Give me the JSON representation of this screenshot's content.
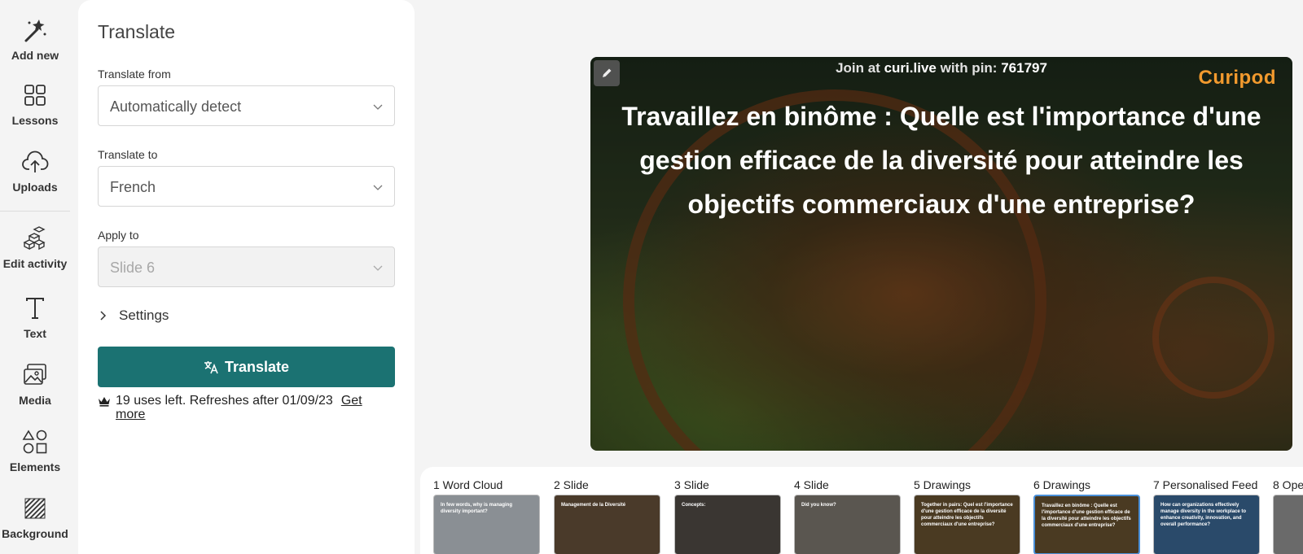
{
  "rail": {
    "items": [
      {
        "label": "Add new",
        "icon": "magic-wand-icon"
      },
      {
        "label": "Lessons",
        "icon": "grid-icon"
      },
      {
        "label": "Uploads",
        "icon": "cloud-upload-icon"
      },
      {
        "label": "Edit activity",
        "icon": "blocks-icon"
      },
      {
        "label": "Text",
        "icon": "text-icon"
      },
      {
        "label": "Media",
        "icon": "image-icon"
      },
      {
        "label": "Elements",
        "icon": "shapes-icon"
      },
      {
        "label": "Background",
        "icon": "hatch-icon"
      }
    ]
  },
  "panel": {
    "title": "Translate",
    "from": {
      "label": "Translate from",
      "value": "Automatically detect"
    },
    "to": {
      "label": "Translate to",
      "value": "French"
    },
    "apply": {
      "label": "Apply to",
      "value": "Slide 6",
      "disabled": true
    },
    "settings_label": "Settings",
    "translate_label": "Translate",
    "uses_text": "19 uses left. Refreshes after 01/09/23",
    "get_more": "Get more"
  },
  "slide": {
    "pin_prefix": "Join at",
    "pin_site": "curi.live",
    "pin_middle": "with pin:",
    "pin_code": "761797",
    "logo": "Curipod",
    "title": "Travaillez en binôme : Quelle est l'importance d'une gestion efficace de la diversité pour atteindre les objectifs commerciaux d'une entreprise?"
  },
  "thumbs": [
    {
      "label": "1 Word Cloud",
      "text": "In few words, why is managing diversity important?",
      "bg": "#8a8f94"
    },
    {
      "label": "2 Slide",
      "text": "Management de la Diversité",
      "bg": "#4a3a2a"
    },
    {
      "label": "3 Slide",
      "text": "Concepts:",
      "bg": "#3a3632"
    },
    {
      "label": "4 Slide",
      "text": "Did you know?",
      "bg": "#5a5650"
    },
    {
      "label": "5 Drawings",
      "text": "Together in pairs: Quel est l'importance d'une gestion efficace de la diversité pour atteindre les objectifs commerciaux d'une entreprise?",
      "bg": "#4a3a22"
    },
    {
      "label": "6 Drawings",
      "text": "Travaillez en binôme : Quelle est l'importance d'une gestion efficace de la diversité pour atteindre les objectifs commerciaux d'une entreprise?",
      "bg": "#4a3a22"
    },
    {
      "label": "7 Personalised Feed",
      "text": "How can organizations effectively manage diversity in the workplace to enhance creativity, innovation, and overall performance?",
      "bg": "#2a4a6a"
    },
    {
      "label": "8 Ope",
      "text": "",
      "bg": "#6a6a6a"
    }
  ],
  "colors": {
    "accent": "#1b7272",
    "logo": "#f29a2e",
    "active_thumb": "#4a90d9"
  }
}
